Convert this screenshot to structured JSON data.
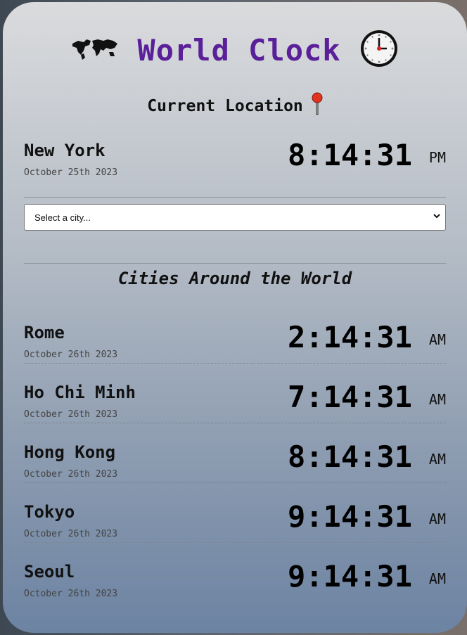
{
  "header": {
    "title": "World Clock",
    "left_icon": "world-map-icon",
    "right_icon": "clock-icon"
  },
  "current": {
    "label": "Current Location",
    "icon": "pushpin-icon",
    "city": "New York",
    "date": "October 25th 2023",
    "time": "8:14:31",
    "ampm": "PM"
  },
  "select": {
    "value": "Select a city..."
  },
  "section_title": "Cities Around the World",
  "cities": [
    {
      "name": "Rome",
      "date": "October 26th 2023",
      "time": "2:14:31",
      "ampm": "AM"
    },
    {
      "name": "Ho Chi Minh",
      "date": "October 26th 2023",
      "time": "7:14:31",
      "ampm": "AM"
    },
    {
      "name": "Hong Kong",
      "date": "October 26th 2023",
      "time": "8:14:31",
      "ampm": "AM"
    },
    {
      "name": "Tokyo",
      "date": "October 26th 2023",
      "time": "9:14:31",
      "ampm": "AM"
    },
    {
      "name": "Seoul",
      "date": "October 26th 2023",
      "time": "9:14:31",
      "ampm": "AM"
    }
  ],
  "colors": {
    "title": "#5a1f99",
    "card_top": "#dadbdd",
    "card_bottom": "#6c83a2"
  }
}
